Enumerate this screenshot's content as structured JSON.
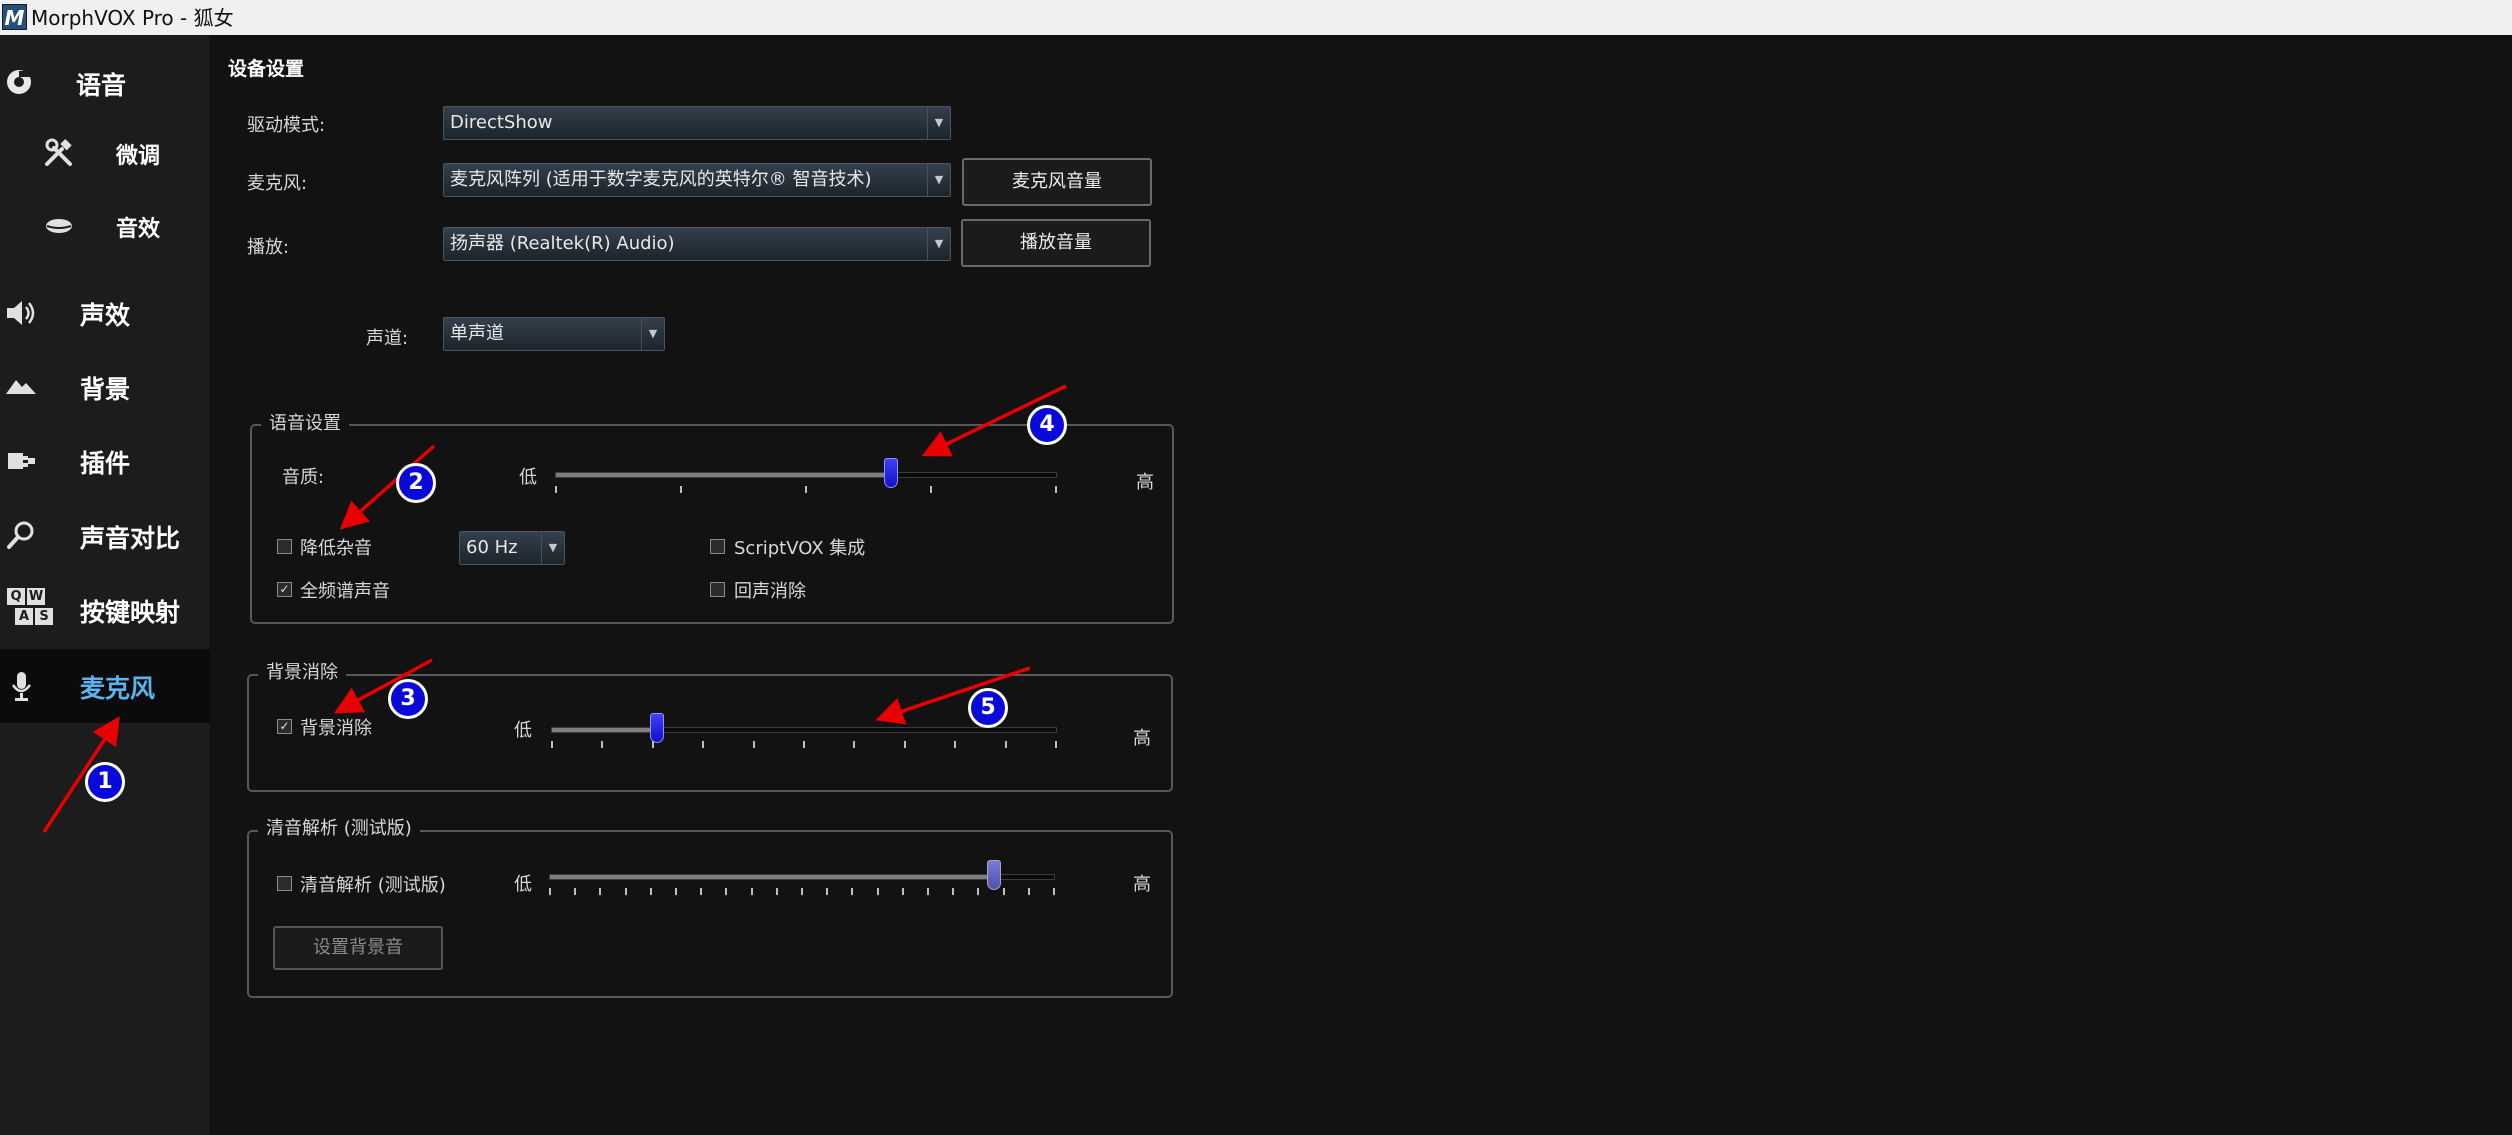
{
  "title_bar": {
    "logo_text": "M",
    "title": "MorphVOX Pro - 狐女"
  },
  "sidebar": {
    "items": [
      {
        "label": "语音",
        "icon": "voice-icon"
      },
      {
        "label": "微调",
        "icon": "tools-icon"
      },
      {
        "label": "音效",
        "icon": "lips-icon"
      },
      {
        "label": "声效",
        "icon": "speaker-icon"
      },
      {
        "label": "背景",
        "icon": "background-icon"
      },
      {
        "label": "插件",
        "icon": "plugin-icon"
      },
      {
        "label": "声音对比",
        "icon": "search-icon"
      },
      {
        "label": "按键映射",
        "icon": "keyboard-icon",
        "keys": [
          "Q",
          "W",
          "A",
          "S"
        ]
      },
      {
        "label": "麦克风",
        "icon": "microphone-icon",
        "active": true
      }
    ]
  },
  "device": {
    "header": "设备设置",
    "driver_label": "驱动模式:",
    "driver_value": "DirectShow",
    "mic_label": "麦克风:",
    "mic_value": "麦克风阵列 (适用于数字麦克风的英特尔® 智音技术)",
    "mic_volume_button": "麦克风音量",
    "playback_label": "播放:",
    "playback_value": "扬声器 (Realtek(R) Audio)",
    "playback_volume_button": "播放音量",
    "channel_label": "声道:",
    "channel_value": "单声道"
  },
  "voice_settings": {
    "legend": "语音设置",
    "quality_label": "音质:",
    "low": "低",
    "high": "高",
    "quality_value": 0.67,
    "noise_reduction": {
      "label": "降低杂音",
      "checked": false
    },
    "hum_filter_value": "60 Hz",
    "full_spectrum": {
      "label": "全频谱声音",
      "checked": true
    },
    "scriptvox": {
      "label": "ScriptVOX 集成",
      "checked": false
    },
    "echo_cancel": {
      "label": "回声消除",
      "checked": false
    }
  },
  "background_cancel": {
    "legend": "背景消除",
    "checkbox": {
      "label": "背景消除",
      "checked": true
    },
    "low": "低",
    "high": "高",
    "level": 0.21
  },
  "vocal_isolation": {
    "legend": "清音解析 (测试版)",
    "checkbox": {
      "label": "清音解析 (测试版)",
      "checked": false
    },
    "low": "低",
    "high": "高",
    "level": 0.88,
    "set_background_button": "设置背景音"
  },
  "annotations": {
    "badges": [
      "1",
      "2",
      "3",
      "4",
      "5"
    ],
    "color_arrow": "#e80000",
    "color_badge": "#0a0ad8"
  },
  "check_mark": "✓"
}
